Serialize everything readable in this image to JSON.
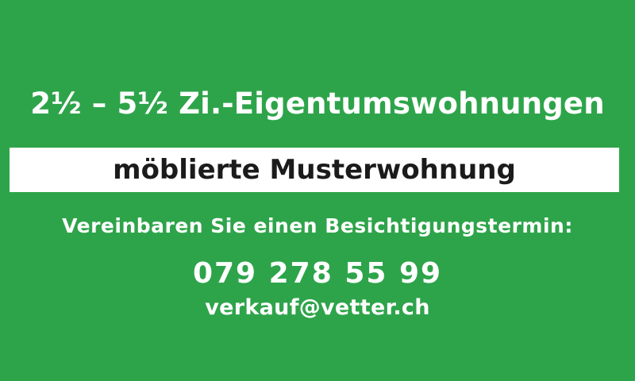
{
  "sign": {
    "background_color": "#2ea44a",
    "text_color": "#ffffff",
    "headline": "2½ – 5½ Zi.-Eigentumswohnungen",
    "banner": {
      "text": "möblierte Musterwohnung",
      "background_color": "#ffffff",
      "text_color": "#1b1b1b"
    },
    "prompt": "Vereinbaren Sie einen Besichtigungstermin:",
    "phone": "079 278 55 99",
    "email": "verkauf@vetter.ch"
  }
}
